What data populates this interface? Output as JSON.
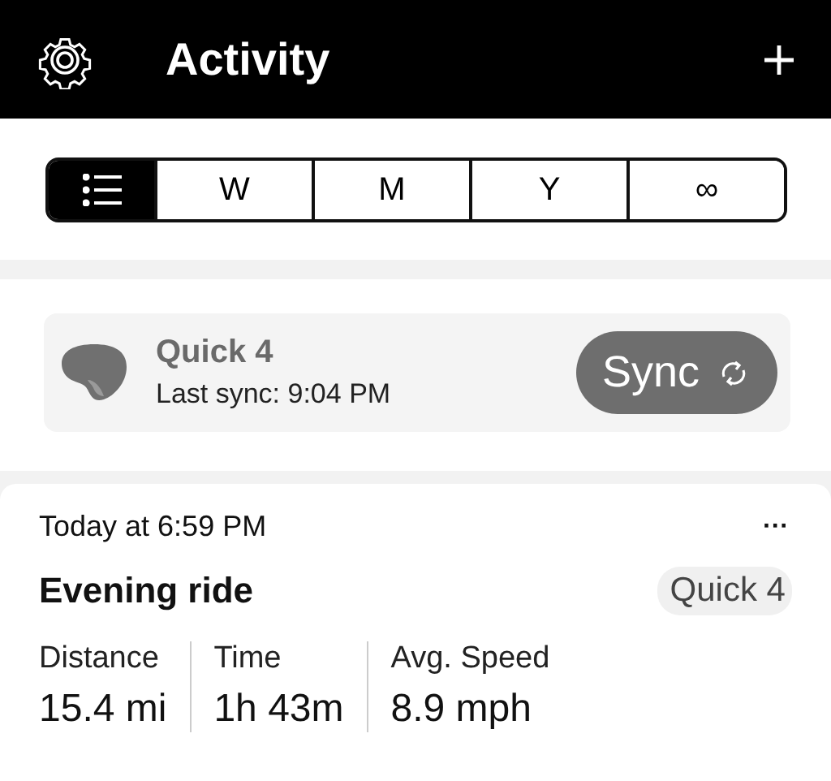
{
  "header": {
    "title": "Activity"
  },
  "tabs": [
    {
      "kind": "list",
      "selected": true
    },
    {
      "kind": "text",
      "label": "W",
      "selected": false
    },
    {
      "kind": "text",
      "label": "M",
      "selected": false
    },
    {
      "kind": "text",
      "label": "Y",
      "selected": false
    },
    {
      "kind": "text",
      "label": "∞",
      "selected": false
    }
  ],
  "device": {
    "name": "Quick 4",
    "last_sync": "Last sync: 9:04 PM",
    "button": "Sync"
  },
  "activity": {
    "time": "Today at 6:59 PM",
    "menu": "···",
    "title": "Evening ride",
    "device_tag": "Quick 4",
    "stats": [
      {
        "label": "Distance",
        "value": "15.4 mi"
      },
      {
        "label": "Time",
        "value": "1h 43m"
      },
      {
        "label": "Avg. Speed",
        "value": "8.9 mph"
      }
    ]
  }
}
